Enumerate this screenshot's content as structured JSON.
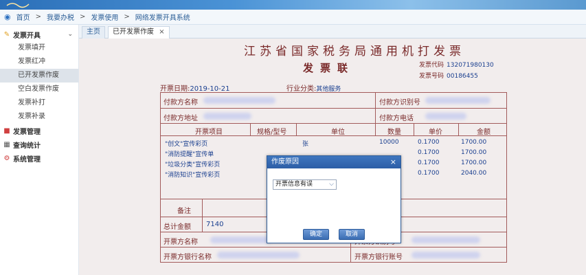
{
  "crumbs": [
    "首页",
    "我要办税",
    "发票使用",
    "网络发票开具系统"
  ],
  "sidebar": {
    "group_invoice": "发票开具",
    "items": [
      "发票填开",
      "发票红冲",
      "已开发票作废",
      "空白发票作废",
      "发票补打",
      "发票补录"
    ],
    "group_manage": "发票管理",
    "group_query": "查询统计",
    "group_system": "系统管理"
  },
  "tabs": {
    "home": "主页",
    "current": "已开发票作废",
    "close": "×"
  },
  "invoice": {
    "title": "江苏省国家税务局通用机打发票",
    "subtitle": "发票联",
    "code_label": "发票代码",
    "code_value": "132071980130",
    "number_label": "发票号码",
    "number_value": "00186455",
    "date_label": "开票日期:",
    "date_value": "2019-10-21",
    "industry_label": "行业分类:",
    "industry_value": "其他服务",
    "payer_name_label": "付款方名称",
    "payer_id_label": "付款方识别号",
    "payer_addr_label": "付款方地址",
    "payer_phone_label": "付款方电话",
    "columns": [
      "开票项目",
      "规格/型号",
      "单位",
      "数量",
      "单价",
      "金额"
    ],
    "items": [
      {
        "name": "\"创文\"宣传彩页",
        "unit": "张",
        "qty": "10000",
        "price": "0.1700",
        "amount": "1700.00"
      },
      {
        "name": "\"消防提醒\"宣传单",
        "unit": "",
        "qty": "",
        "price": "0.1700",
        "amount": "1700.00"
      },
      {
        "name": "\"垃圾分类\"宣传彩页",
        "unit": "",
        "qty": "",
        "price": "0.1700",
        "amount": "1700.00"
      },
      {
        "name": "\"消防知识\"宣传彩页",
        "unit": "",
        "qty": "",
        "price": "0.1700",
        "amount": "2040.00"
      }
    ],
    "remark_label": "备注",
    "total_label": "总计金额",
    "total_value": "7140",
    "issuer_name_label": "开票方名称",
    "issuer_id_label": "开票方识别号",
    "issuer_bank_label": "开票方银行名称",
    "issuer_account_label": "开票方银行账号"
  },
  "dialog": {
    "title": "作废原因",
    "close": "×",
    "selected_reason": "开票信息有误",
    "ok": "确定",
    "cancel": "取消"
  }
}
